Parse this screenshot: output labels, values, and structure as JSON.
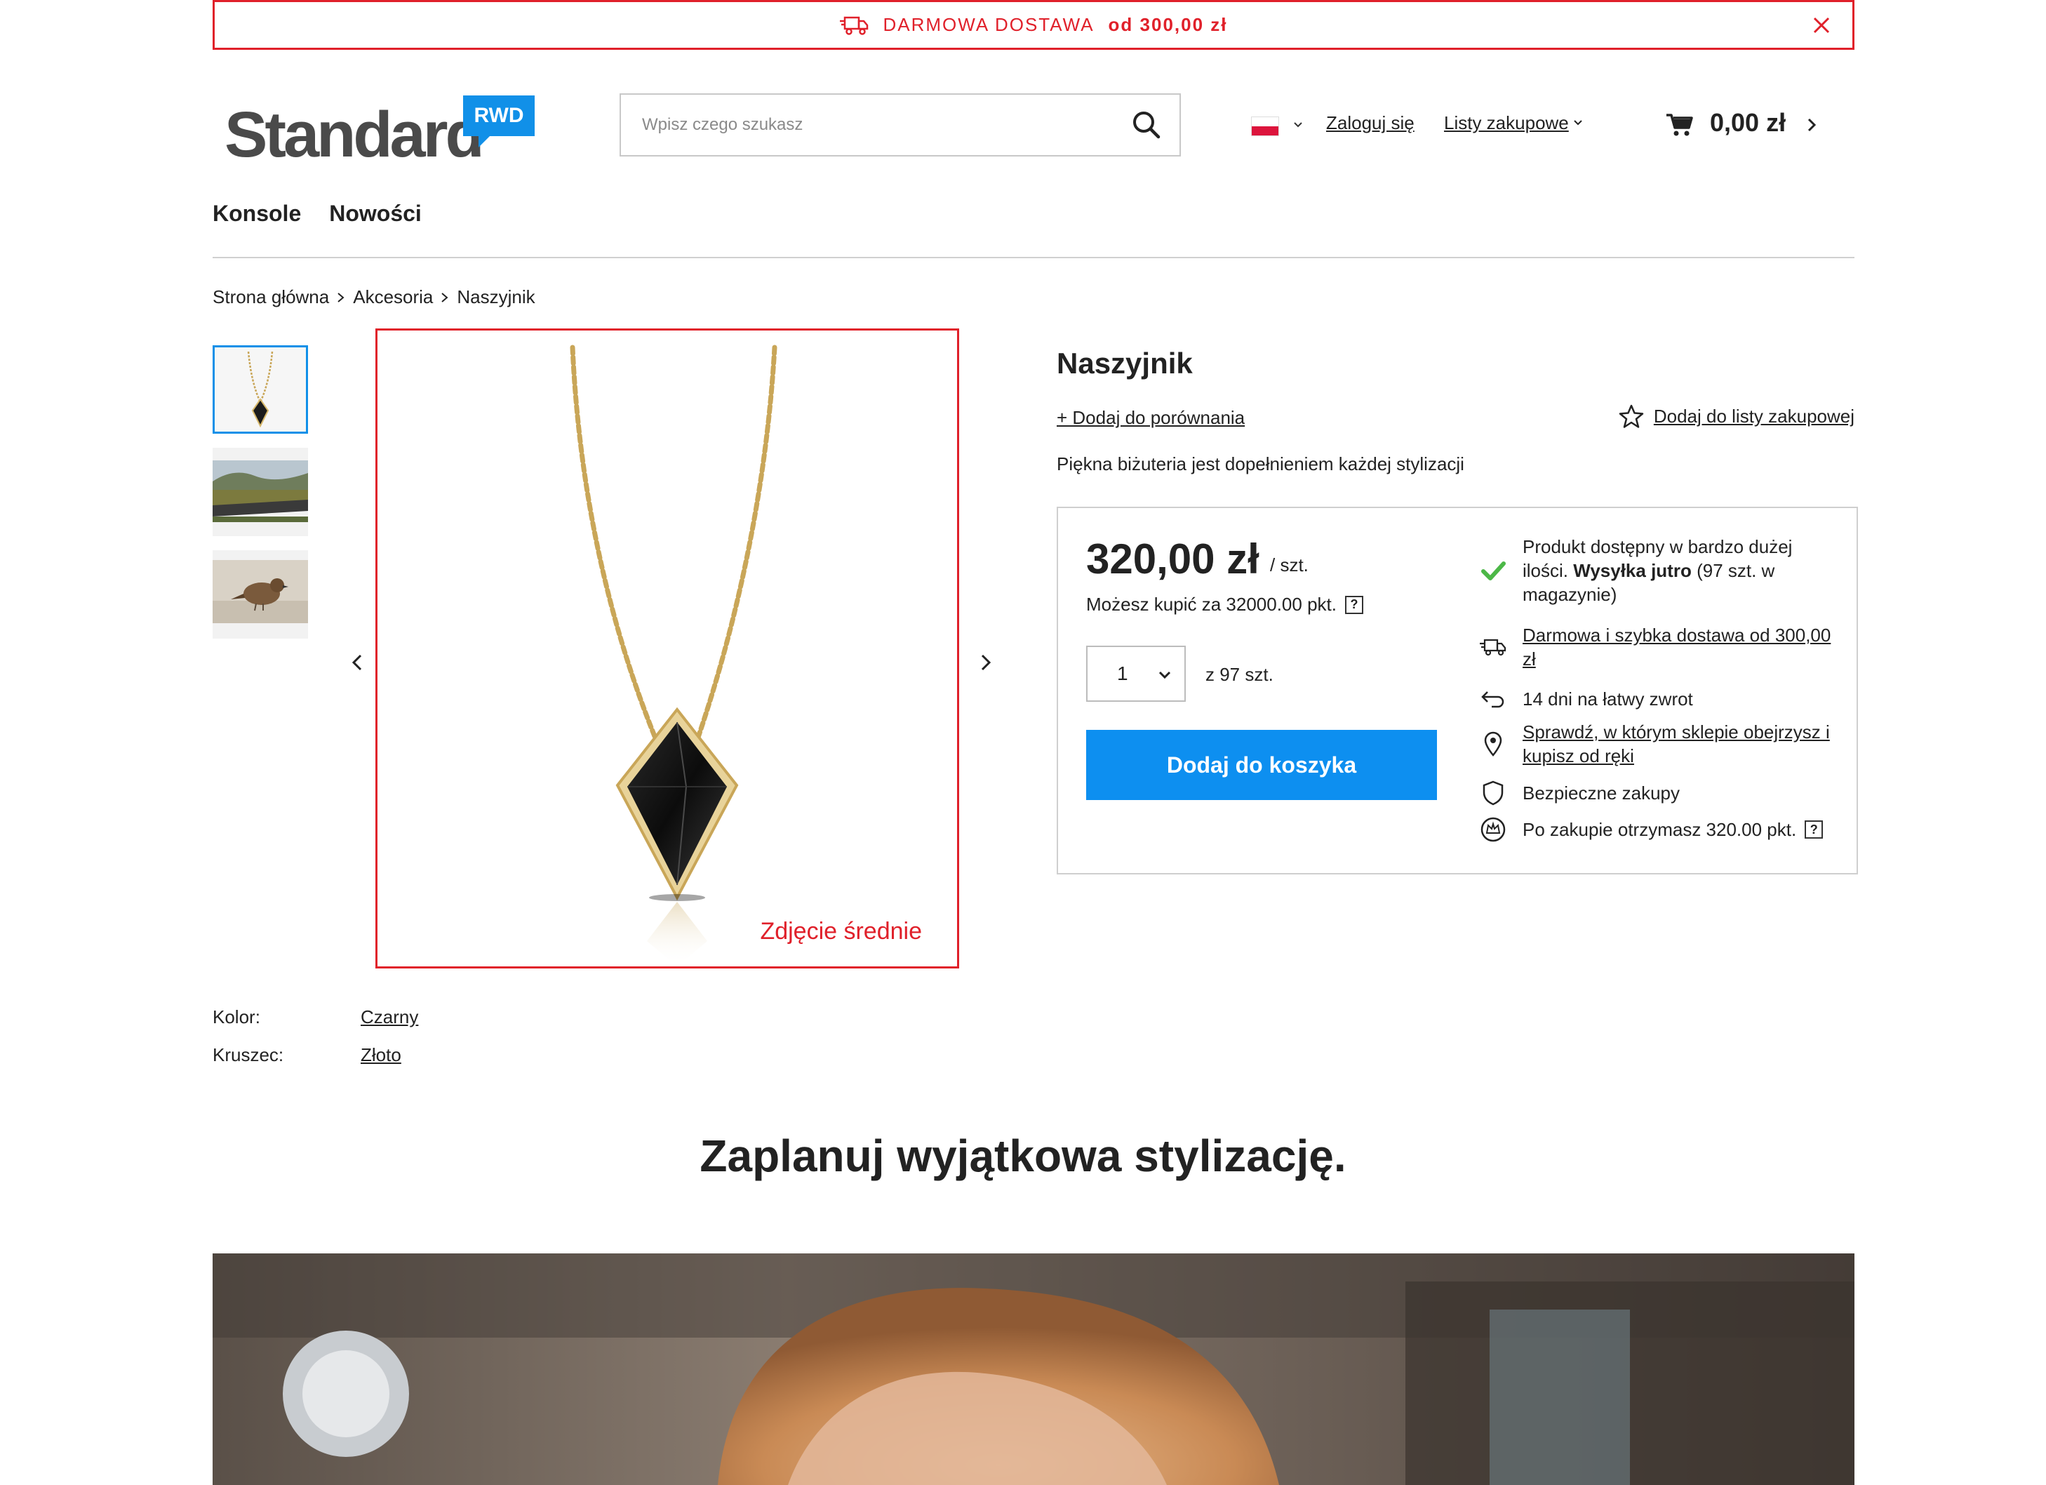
{
  "promo": {
    "text": "DARMOWA DOSTAWA",
    "highlight": "od 300,00 zł",
    "icon": "delivery-truck-icon",
    "close_icon": "close-icon",
    "color": "#e0202a"
  },
  "header": {
    "logo_text": "Standard",
    "logo_badge": "RWD",
    "search_placeholder": "Wpisz czego szukasz",
    "language_flag": "flag-poland-icon",
    "login_label": "Zaloguj się",
    "lists_label": "Listy zakupowe",
    "cart_total": "0,00 zł"
  },
  "nav": {
    "items": [
      {
        "label": "Konsole"
      },
      {
        "label": "Nowości"
      }
    ]
  },
  "breadcrumb": {
    "items": [
      {
        "label": "Strona główna"
      },
      {
        "label": "Akcesoria"
      },
      {
        "label": "Naszyjnik"
      }
    ]
  },
  "gallery": {
    "thumbnails": [
      {
        "subject": "necklace",
        "selected": true
      },
      {
        "subject": "landscape-road"
      },
      {
        "subject": "sparrow"
      }
    ],
    "main_caption": "Zdjęcie średnie"
  },
  "product": {
    "title": "Naszyjnik",
    "compare_label": "+ Dodaj do porównania",
    "wishlist_label": "Dodaj do listy zakupowej",
    "description": "Piękna biżuteria jest dopełnieniem każdej stylizacji",
    "price": "320,00 zł",
    "unit": "/ szt.",
    "points_text": "Możesz kupić za 32000.00 pkt.",
    "quantity": "1",
    "stock_of": "z 97 szt.",
    "add_to_cart_label": "Dodaj do koszyka",
    "accent_color": "#0d8ff0",
    "benefits": {
      "availability_pre": "Produkt dostępny w bardzo dużej ilości.",
      "availability_bold": "Wysyłka jutro",
      "availability_post": "(97 szt. w magazynie)",
      "delivery": "Darmowa i szybka dostawa od 300,00 zł",
      "returns": "14 dni na łatwy zwrot",
      "stores": "Sprawdź, w którym sklepie obejrzysz i kupisz od ręki",
      "secure": "Bezpieczne zakupy",
      "earn_points": "Po zakupie otrzymasz 320.00 pkt."
    }
  },
  "attributes": [
    {
      "label": "Kolor:",
      "value": "Czarny"
    },
    {
      "label": "Kruszec:",
      "value": "Złoto"
    }
  ],
  "section": {
    "title": "Zaplanuj wyjątkowa stylizację."
  }
}
